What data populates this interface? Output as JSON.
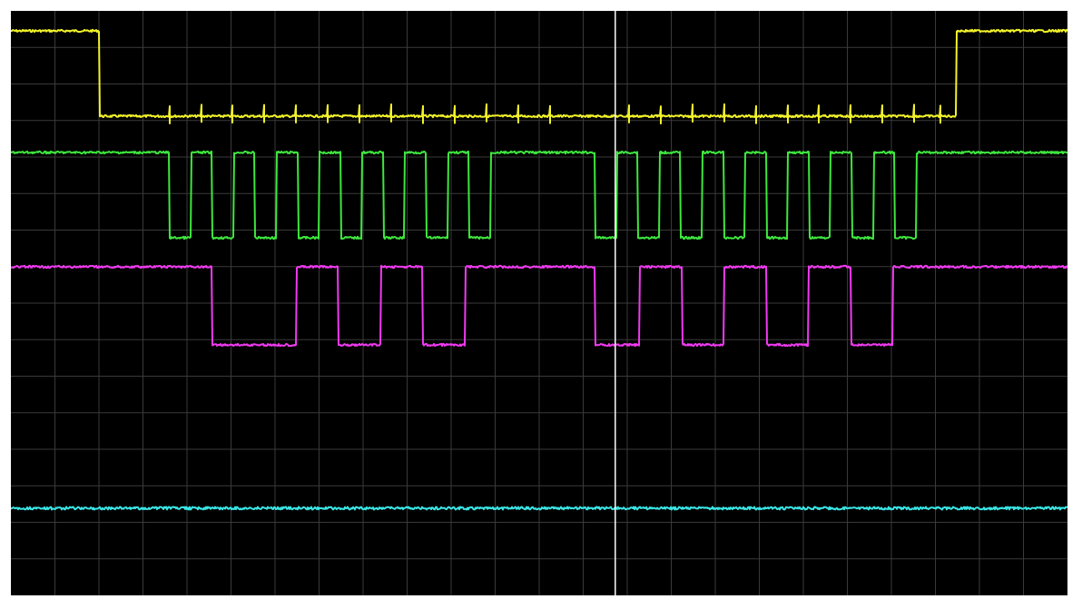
{
  "screen": {
    "background": "#000000",
    "grid_color": "#3a3a3a",
    "cursor_color": "#ffffff",
    "horizontal_divisions": 24,
    "vertical_divisions": 16
  },
  "channels": [
    {
      "name": "",
      "color": "#f2f22a",
      "pattern": "high-low-high",
      "high": 1,
      "low": 0,
      "transitions": [
        0.084,
        0.895
      ],
      "spike_positions": [
        0.15,
        0.18,
        0.21,
        0.24,
        0.27,
        0.3,
        0.33,
        0.36,
        0.39,
        0.42,
        0.45,
        0.48,
        0.51,
        0.585,
        0.615,
        0.645,
        0.675,
        0.705,
        0.735,
        0.765,
        0.795,
        0.825,
        0.855,
        0.88
      ]
    },
    {
      "name": "",
      "color": "#3ee63e",
      "pattern": "clock-bursts",
      "high": 1,
      "low": 0,
      "bursts": [
        {
          "start": 0.15,
          "pulses": 8,
          "period": 0.0405,
          "duty": 0.5
        },
        {
          "start": 0.553,
          "pulses": 8,
          "period": 0.0405,
          "duty": 0.5
        }
      ]
    },
    {
      "name": "",
      "color": "#f03af0",
      "pattern": "data",
      "high": 1,
      "low": 0,
      "segments": [
        [
          0.0,
          0.19,
          1
        ],
        [
          0.19,
          0.27,
          0
        ],
        [
          0.27,
          0.31,
          1
        ],
        [
          0.31,
          0.35,
          0
        ],
        [
          0.35,
          0.39,
          1
        ],
        [
          0.39,
          0.43,
          0
        ],
        [
          0.43,
          0.553,
          1
        ],
        [
          0.553,
          0.595,
          0
        ],
        [
          0.595,
          0.635,
          1
        ],
        [
          0.635,
          0.675,
          0
        ],
        [
          0.675,
          0.715,
          1
        ],
        [
          0.715,
          0.755,
          0
        ],
        [
          0.755,
          0.795,
          1
        ],
        [
          0.795,
          0.835,
          0
        ],
        [
          0.835,
          1.0,
          1
        ]
      ]
    },
    {
      "name": "",
      "color": "#3ae6e6",
      "pattern": "flat",
      "high": 0,
      "low": 0
    }
  ],
  "cursor": {
    "position": 0.572
  }
}
